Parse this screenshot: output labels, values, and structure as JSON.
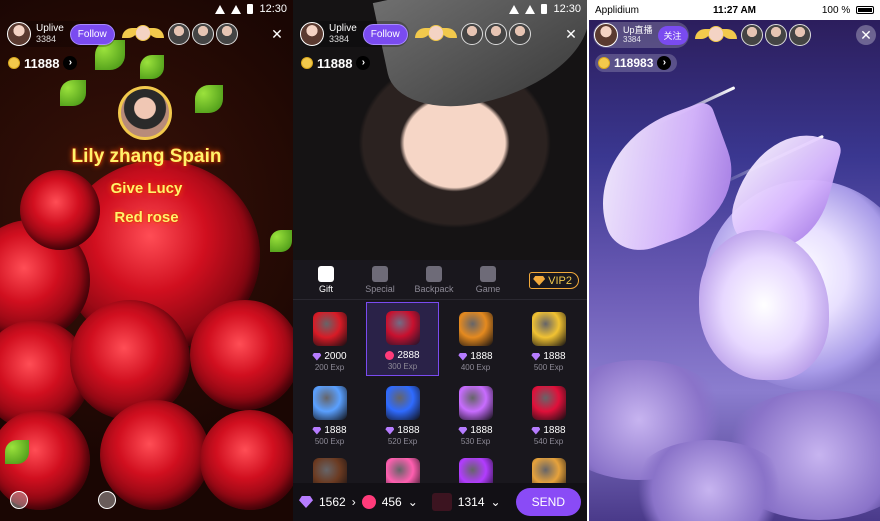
{
  "screen1": {
    "status_time": "12:30",
    "host": {
      "name": "Uplive",
      "count": "3384"
    },
    "follow_label": "Follow",
    "coins": "11888",
    "gift_sender": "Lily zhang Spain",
    "gift_line1": "Give Lucy",
    "gift_line2": "Red rose"
  },
  "screen2": {
    "status_time": "12:30",
    "host": {
      "name": "Uplive",
      "count": "3384"
    },
    "follow_label": "Follow",
    "coins": "11888",
    "tabs": [
      {
        "label": "Gift"
      },
      {
        "label": "Special"
      },
      {
        "label": "Backpack"
      },
      {
        "label": "Game"
      }
    ],
    "vip_label": "VIP2",
    "gifts": [
      {
        "price": "2000",
        "exp": "200 Exp",
        "currency": "diamond",
        "icon": "red-envelope-icon",
        "color": "#d81b26"
      },
      {
        "price": "2888",
        "exp": "300 Exp",
        "currency": "ruby",
        "icon": "rose-bouquet-icon",
        "color": "#c8102e"
      },
      {
        "price": "1888",
        "exp": "400 Exp",
        "currency": "diamond",
        "icon": "coffee-cup-icon",
        "color": "#e58a1f"
      },
      {
        "price": "1888",
        "exp": "500 Exp",
        "currency": "diamond",
        "icon": "beer-mug-icon",
        "color": "#f1c232"
      },
      {
        "price": "1888",
        "exp": "500 Exp",
        "currency": "diamond",
        "icon": "glass-slipper-icon",
        "color": "#5aa0ff"
      },
      {
        "price": "1888",
        "exp": "520 Exp",
        "currency": "diamond",
        "icon": "heart-necklace-icon",
        "color": "#2f6bff"
      },
      {
        "price": "1888",
        "exp": "530 Exp",
        "currency": "diamond",
        "icon": "ring-icon",
        "color": "#c86cff"
      },
      {
        "price": "1888",
        "exp": "540 Exp",
        "currency": "diamond",
        "icon": "lips-icon",
        "color": "#e0103a"
      },
      {
        "price": "",
        "exp": "",
        "currency": "",
        "icon": "chocolate-icon",
        "color": "#6b3a21"
      },
      {
        "price": "",
        "exp": "",
        "currency": "",
        "icon": "number-666-icon",
        "color": "#ff5fb0"
      },
      {
        "price": "",
        "exp": "",
        "currency": "",
        "icon": "flower-basket-icon",
        "color": "#b23cff"
      },
      {
        "price": "",
        "exp": "",
        "currency": "",
        "icon": "bear-icon",
        "color": "#e6a23c"
      }
    ],
    "bottom": {
      "diamonds": "1562",
      "rubies": "456",
      "quantity": "1314",
      "send_label": "SEND"
    }
  },
  "screen3": {
    "carrier": "Applidium",
    "status_time": "11:27 AM",
    "battery": "100 %",
    "host": {
      "name": "Up直播",
      "count": "3384"
    },
    "follow_label": "关注",
    "coins": "118983"
  },
  "colors": {
    "accent": "#7a4bf0",
    "send": "#8a4bf6",
    "coin": "#f2c94c",
    "gift_text": "#fff36b"
  }
}
